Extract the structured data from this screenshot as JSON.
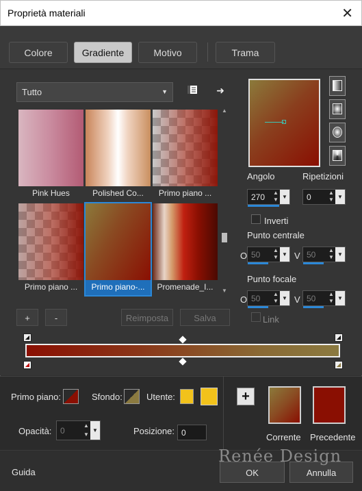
{
  "window": {
    "title": "Proprietà materiali",
    "close_glyph": "✕"
  },
  "tabs": [
    {
      "label": "Colore",
      "selected": false
    },
    {
      "label": "Gradiente",
      "selected": true
    },
    {
      "label": "Motivo",
      "selected": false
    },
    {
      "label": "Trama",
      "selected": false
    }
  ],
  "category": {
    "selected": "Tutto"
  },
  "gradients": [
    {
      "label": "Pink Hues",
      "selected": false
    },
    {
      "label": "Polished Co...",
      "selected": false
    },
    {
      "label": "Primo piano ...",
      "selected": false
    },
    {
      "label": "Primo piano ...",
      "selected": false
    },
    {
      "label": "Primo piano-...",
      "selected": true
    },
    {
      "label": "Promenade_I...",
      "selected": false
    }
  ],
  "list_buttons": {
    "add": "+",
    "remove": "-",
    "reset": "Reimposta",
    "save": "Salva"
  },
  "settings": {
    "angle_label": "Angolo",
    "angle_value": "270",
    "repeats_label": "Ripetizioni",
    "repeats_value": "0",
    "invert_label": "Inverti",
    "invert_checked": false,
    "center_label": "Punto centrale",
    "center_h_label": "O",
    "center_h_value": "50",
    "center_v_label": "V",
    "center_v_value": "50",
    "focal_label": "Punto focale",
    "focal_h_label": "O",
    "focal_h_value": "50",
    "focal_v_label": "V",
    "focal_v_value": "50",
    "link_label": "Link",
    "link_checked": false
  },
  "colors": {
    "foreground_label": "Primo piano:",
    "background_label": "Sfondo:",
    "user_label": "Utente:",
    "opacity_label": "Opacità:",
    "opacity_value": "0",
    "position_label": "Posizione:",
    "position_value": "0",
    "dark_red": "#8a0f02",
    "olive": "#8b7a40",
    "yellow": "#f2c21b"
  },
  "compare": {
    "current_label": "Corrente",
    "previous_label": "Precedente"
  },
  "footer": {
    "help": "Guida",
    "ok": "OK",
    "cancel": "Annulla"
  },
  "watermark": "Renée Design"
}
